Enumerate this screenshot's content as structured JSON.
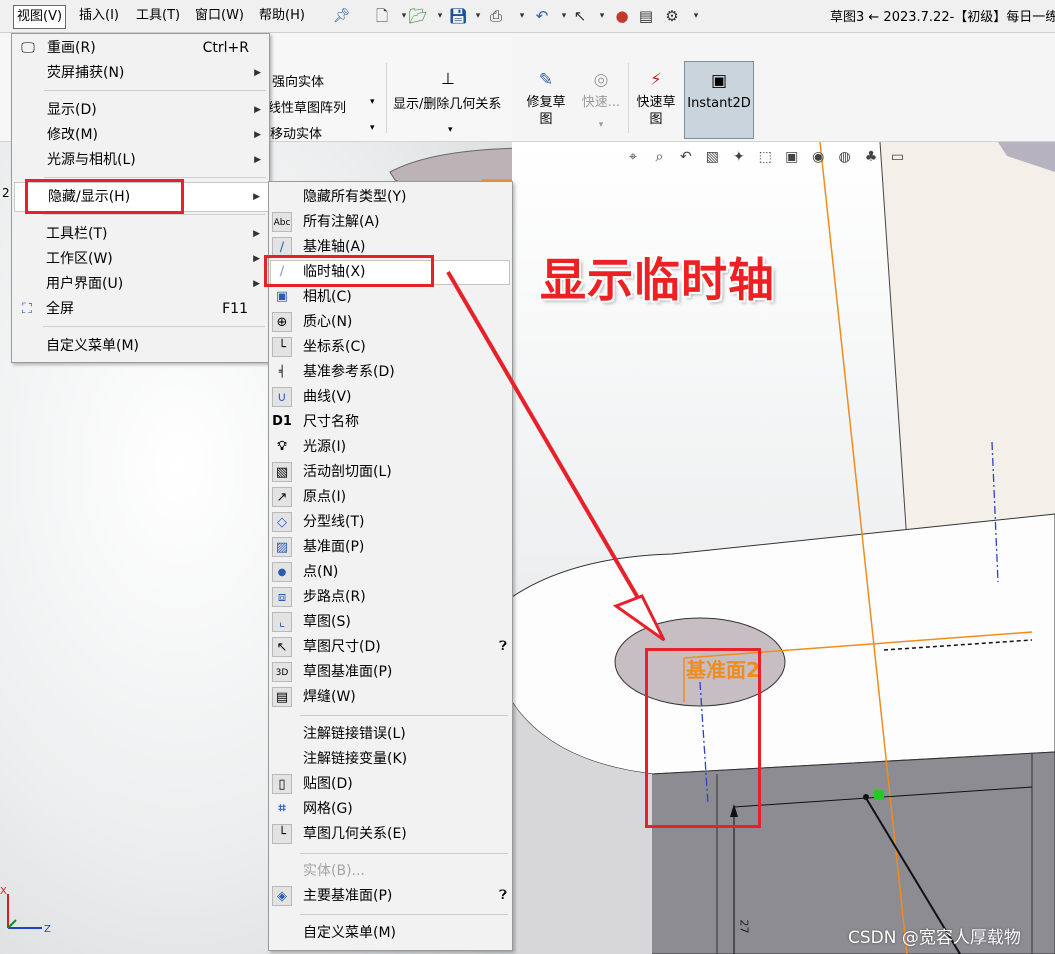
{
  "menubar": {
    "items": [
      "视图(V)",
      "插入(I)",
      "工具(T)",
      "窗口(W)",
      "帮助(H)"
    ],
    "active_index": 0,
    "pin_icon": "pin-icon"
  },
  "window": {
    "title": "草图3 ← 2023.7.22-【初级】每日一练"
  },
  "ribbon": {
    "left_labels": [
      "强向实体",
      "线性草图阵列",
      "移动实体"
    ],
    "show_delete_relations": "显示/删除几何关系",
    "buttons": [
      {
        "label": "修复草\n图",
        "icon": "repair-sketch-icon"
      },
      {
        "label": "快速...",
        "icon": "quick-snap-icon",
        "disabled": true
      },
      {
        "label": "快速草\n图",
        "icon": "rapid-sketch-icon"
      },
      {
        "label": "Instant2D",
        "icon": "instant2d-icon",
        "active": true
      }
    ]
  },
  "view_menu": {
    "items": [
      {
        "label": "重画(R)",
        "shortcut": "Ctrl+R",
        "icon": "redraw-icon"
      },
      {
        "label": "荧屏捕获(N)",
        "submenu": true
      },
      {
        "label": "显示(D)",
        "submenu": true
      },
      {
        "label": "修改(M)",
        "submenu": true
      },
      {
        "label": "光源与相机(L)",
        "submenu": true
      },
      {
        "label": "隐藏/显示(H)",
        "submenu": true,
        "highlighted": true
      },
      {
        "label": "工具栏(T)",
        "submenu": true
      },
      {
        "label": "工作区(W)",
        "submenu": true
      },
      {
        "label": "用户界面(U)",
        "submenu": true
      },
      {
        "label": "全屏",
        "shortcut": "F11",
        "icon": "fullscreen-icon"
      },
      {
        "label": "自定义菜单(M)"
      }
    ]
  },
  "hide_show_menu": {
    "items": [
      {
        "label": "隐藏所有类型(Y)"
      },
      {
        "label": "所有注解(A)",
        "icon": "annotations-icon"
      },
      {
        "label": "基准轴(A)",
        "icon": "axis-icon"
      },
      {
        "label": "临时轴(X)",
        "icon": "temporary-axis-icon",
        "highlighted": true
      },
      {
        "label": "相机(C)",
        "icon": "camera-icon"
      },
      {
        "label": "质心(N)",
        "icon": "center-of-mass-icon"
      },
      {
        "label": "坐标系(C)",
        "icon": "coordinate-system-icon"
      },
      {
        "label": "基准参考系(D)",
        "icon": "datum-reference-icon"
      },
      {
        "label": "曲线(V)",
        "icon": "curve-icon"
      },
      {
        "label": "尺寸名称",
        "icon": "dimension-name-icon",
        "icon_text": "D1"
      },
      {
        "label": "光源(I)",
        "icon": "light-bulb-icon"
      },
      {
        "label": "活动剖切面(L)",
        "icon": "section-plane-icon"
      },
      {
        "label": "原点(I)",
        "icon": "origin-icon"
      },
      {
        "label": "分型线(T)",
        "icon": "parting-line-icon"
      },
      {
        "label": "基准面(P)",
        "icon": "plane-icon"
      },
      {
        "label": "点(N)",
        "icon": "point-icon"
      },
      {
        "label": "步路点(R)",
        "icon": "routing-point-icon"
      },
      {
        "label": "草图(S)",
        "icon": "sketch-icon"
      },
      {
        "label": "草图尺寸(D)",
        "icon": "sketch-dimension-icon",
        "hint": "help-icon"
      },
      {
        "label": "草图基准面(P)",
        "icon": "sketch-plane-3d-icon"
      },
      {
        "label": "焊缝(W)",
        "icon": "weld-bead-icon"
      },
      {
        "label": "注解链接错误(L)"
      },
      {
        "label": "注解链接变量(K)"
      },
      {
        "label": "贴图(D)",
        "icon": "decal-icon"
      },
      {
        "label": "网格(G)",
        "icon": "grid-icon"
      },
      {
        "label": "草图几何关系(E)",
        "icon": "sketch-relations-icon"
      },
      {
        "label": "实体(B)...",
        "disabled": true
      },
      {
        "label": "主要基准面(P)",
        "icon": "primary-planes-icon",
        "hint": "help-icon"
      },
      {
        "label": "自定义菜单(M)"
      }
    ]
  },
  "annotation": {
    "text": "显示临时轴"
  },
  "viewport": {
    "plane_label": "基准面2",
    "dimension_text": "27",
    "left_marker": "2"
  },
  "watermark": "CSDN @宽容人厚载物",
  "colors": {
    "annotation_red": "#e8202a",
    "sketch_orange": "#f08c1c",
    "axis_blue": "#2b3fd0"
  }
}
